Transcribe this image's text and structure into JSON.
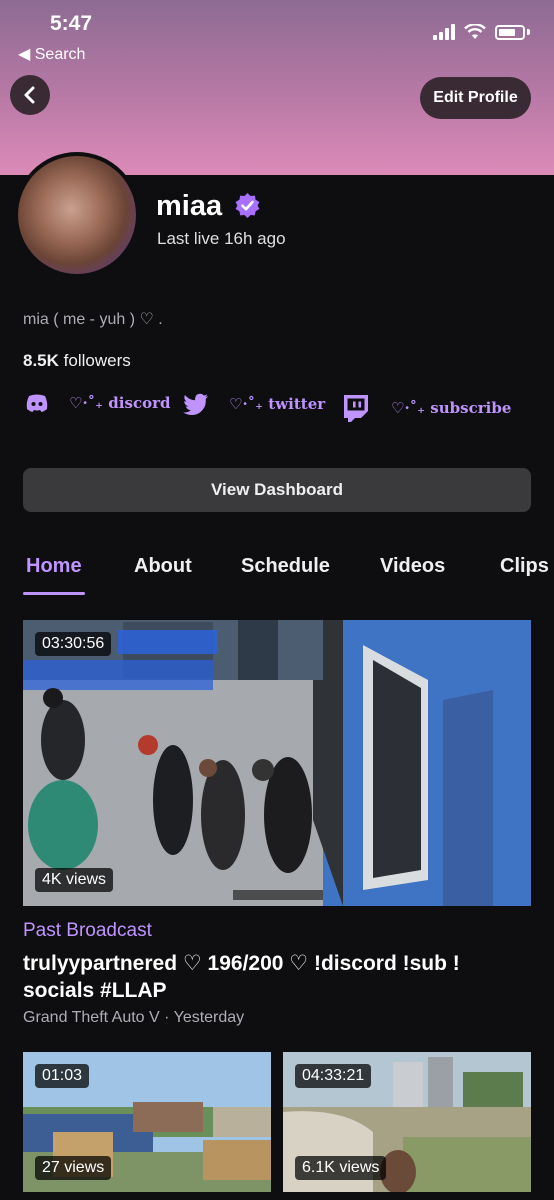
{
  "status": {
    "time": "5:47",
    "back_label": "◀ Search"
  },
  "header": {
    "edit_label": "Edit Profile"
  },
  "profile": {
    "name": "miaa",
    "last_live": "Last live 16h ago",
    "bio": "mia ( me - yuh ) ♡ .",
    "followers_count": "8.5K",
    "followers_label": " followers"
  },
  "socials": [
    {
      "label": "♡·˚₊ discord",
      "icon": "discord-icon"
    },
    {
      "label": "♡·˚₊ twitter",
      "icon": "twitter-icon"
    },
    {
      "label": "♡·˚₊ subscribe",
      "icon": "twitch-icon"
    }
  ],
  "dashboard_label": "View Dashboard",
  "tabs": [
    {
      "label": "Home"
    },
    {
      "label": "About"
    },
    {
      "label": "Schedule"
    },
    {
      "label": "Videos"
    },
    {
      "label": "Clips"
    }
  ],
  "featured": {
    "duration": "03:30:56",
    "views": "4K views",
    "type": "Past Broadcast",
    "title": "trulyypartnered ♡ 196/200 ♡ !discord !sub ! socials #LLAP",
    "meta": "Grand Theft Auto V · Yesterday"
  },
  "videos": [
    {
      "duration": "01:03",
      "views": "27 views"
    },
    {
      "duration": "04:33:21",
      "views": "6.1K views"
    }
  ],
  "colors": {
    "accent": "#bf94ff",
    "background": "#0e0e10",
    "button": "#3a3a3d"
  }
}
